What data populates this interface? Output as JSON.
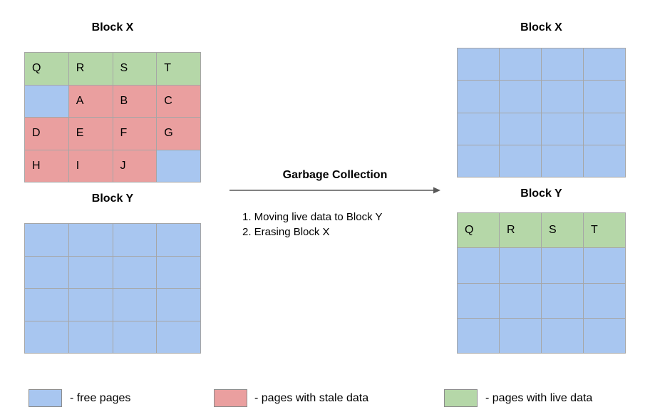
{
  "colors": {
    "free": "#a8c6f0",
    "stale": "#ea9f9f",
    "live": "#b5d7a8",
    "gridline": "#a6a6a6",
    "text": "#000000",
    "arrow": "#595959"
  },
  "left": {
    "block_x": {
      "title": "Block X",
      "rows": [
        [
          {
            "label": "Q",
            "state": "live"
          },
          {
            "label": "R",
            "state": "live"
          },
          {
            "label": "S",
            "state": "live"
          },
          {
            "label": "T",
            "state": "live"
          }
        ],
        [
          {
            "label": "",
            "state": "free"
          },
          {
            "label": "A",
            "state": "stale"
          },
          {
            "label": "B",
            "state": "stale"
          },
          {
            "label": "C",
            "state": "stale"
          }
        ],
        [
          {
            "label": "D",
            "state": "stale"
          },
          {
            "label": "E",
            "state": "stale"
          },
          {
            "label": "F",
            "state": "stale"
          },
          {
            "label": "G",
            "state": "stale"
          }
        ],
        [
          {
            "label": "H",
            "state": "stale"
          },
          {
            "label": "I",
            "state": "stale"
          },
          {
            "label": "J",
            "state": "stale"
          },
          {
            "label": "",
            "state": "free"
          }
        ]
      ]
    },
    "block_y": {
      "title": "Block Y",
      "rows": [
        [
          {
            "label": "",
            "state": "free"
          },
          {
            "label": "",
            "state": "free"
          },
          {
            "label": "",
            "state": "free"
          },
          {
            "label": "",
            "state": "free"
          }
        ],
        [
          {
            "label": "",
            "state": "free"
          },
          {
            "label": "",
            "state": "free"
          },
          {
            "label": "",
            "state": "free"
          },
          {
            "label": "",
            "state": "free"
          }
        ],
        [
          {
            "label": "",
            "state": "free"
          },
          {
            "label": "",
            "state": "free"
          },
          {
            "label": "",
            "state": "free"
          },
          {
            "label": "",
            "state": "free"
          }
        ],
        [
          {
            "label": "",
            "state": "free"
          },
          {
            "label": "",
            "state": "free"
          },
          {
            "label": "",
            "state": "free"
          },
          {
            "label": "",
            "state": "free"
          }
        ]
      ]
    }
  },
  "center": {
    "title": "Garbage Collection",
    "steps": [
      "1. Moving live data to Block Y",
      "2. Erasing Block X"
    ]
  },
  "right": {
    "block_x": {
      "title": "Block X",
      "rows": [
        [
          {
            "label": "",
            "state": "free"
          },
          {
            "label": "",
            "state": "free"
          },
          {
            "label": "",
            "state": "free"
          },
          {
            "label": "",
            "state": "free"
          }
        ],
        [
          {
            "label": "",
            "state": "free"
          },
          {
            "label": "",
            "state": "free"
          },
          {
            "label": "",
            "state": "free"
          },
          {
            "label": "",
            "state": "free"
          }
        ],
        [
          {
            "label": "",
            "state": "free"
          },
          {
            "label": "",
            "state": "free"
          },
          {
            "label": "",
            "state": "free"
          },
          {
            "label": "",
            "state": "free"
          }
        ],
        [
          {
            "label": "",
            "state": "free"
          },
          {
            "label": "",
            "state": "free"
          },
          {
            "label": "",
            "state": "free"
          },
          {
            "label": "",
            "state": "free"
          }
        ]
      ]
    },
    "block_y": {
      "title": "Block Y",
      "rows": [
        [
          {
            "label": "Q",
            "state": "live"
          },
          {
            "label": "R",
            "state": "live"
          },
          {
            "label": "S",
            "state": "live"
          },
          {
            "label": "T",
            "state": "live"
          }
        ],
        [
          {
            "label": "",
            "state": "free"
          },
          {
            "label": "",
            "state": "free"
          },
          {
            "label": "",
            "state": "free"
          },
          {
            "label": "",
            "state": "free"
          }
        ],
        [
          {
            "label": "",
            "state": "free"
          },
          {
            "label": "",
            "state": "free"
          },
          {
            "label": "",
            "state": "free"
          },
          {
            "label": "",
            "state": "free"
          }
        ],
        [
          {
            "label": "",
            "state": "free"
          },
          {
            "label": "",
            "state": "free"
          },
          {
            "label": "",
            "state": "free"
          },
          {
            "label": "",
            "state": "free"
          }
        ]
      ]
    }
  },
  "legend": {
    "items": [
      {
        "state": "free",
        "label": "- free pages"
      },
      {
        "state": "stale",
        "label": "- pages with stale data"
      },
      {
        "state": "live",
        "label": "- pages with live data"
      }
    ]
  }
}
